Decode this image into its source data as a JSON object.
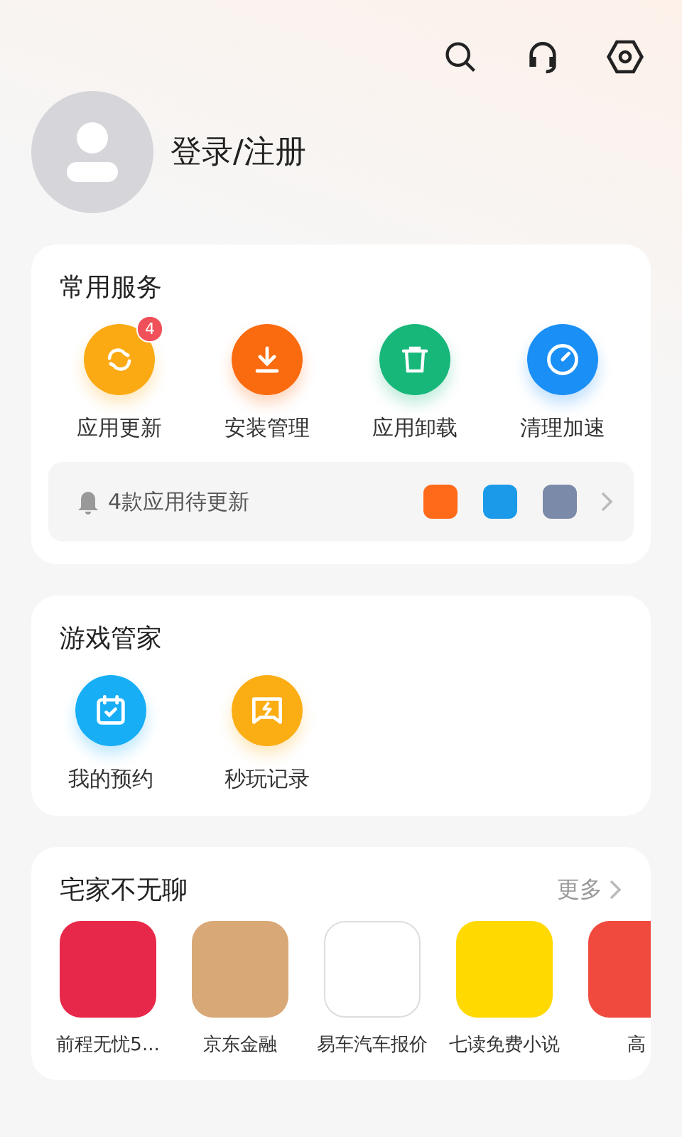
{
  "profile": {
    "login_label": "登录/注册"
  },
  "common_services": {
    "title": "常用服务",
    "items": [
      {
        "label": "应用更新",
        "badge": "4"
      },
      {
        "label": "安装管理"
      },
      {
        "label": "应用卸载"
      },
      {
        "label": "清理加速"
      }
    ],
    "update_notice": {
      "text": "4款应用待更新"
    }
  },
  "game_manager": {
    "title": "游戏管家",
    "items": [
      {
        "label": "我的预约"
      },
      {
        "label": "秒玩记录"
      }
    ]
  },
  "recommend": {
    "title": "宅家不无聊",
    "more": "更多",
    "apps": [
      {
        "name": "前程无忧5..."
      },
      {
        "name": "京东金融"
      },
      {
        "name": "易车汽车报价"
      },
      {
        "name": "七读免费小说"
      },
      {
        "name": "高"
      }
    ]
  }
}
